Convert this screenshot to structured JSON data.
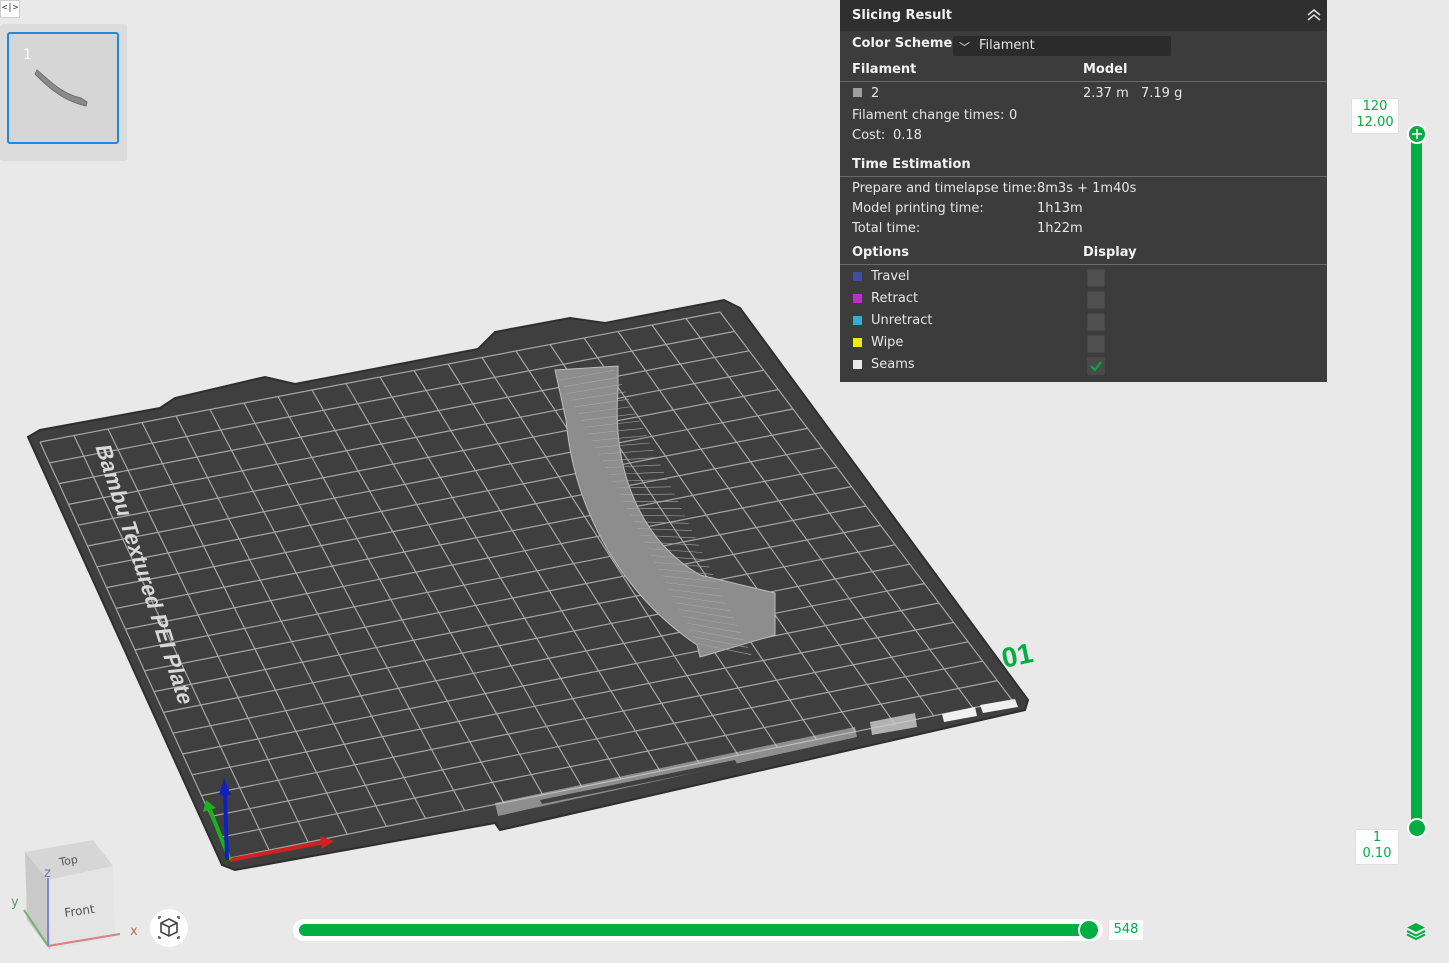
{
  "toolbar": {
    "collapse_icon": "code-bracket-icon",
    "collapse_label": "<|>"
  },
  "plates": [
    {
      "number": "1"
    }
  ],
  "plate": {
    "brand_text": "Bambu Textured PEI Plate",
    "plate_number": "01",
    "grid_color": "#a6a6a6",
    "plate_color": "#3f3f3f",
    "accent": "#00ae42"
  },
  "slicing_result": {
    "title": "Slicing Result",
    "color_scheme_label": "Color Scheme",
    "color_scheme_value": "Filament",
    "filament_header": "Filament",
    "model_header": "Model",
    "filament_rows": [
      {
        "id": "2",
        "length": "2.37 m",
        "weight": "7.19 g",
        "color": "#9e9e9e"
      }
    ],
    "filament_change_label": "Filament change times:",
    "filament_change_value": "0",
    "cost_label": "Cost:",
    "cost_value": "0.18",
    "time_header": "Time Estimation",
    "prepare_label": "Prepare and timelapse time:",
    "prepare_value": "8m3s + 1m40s",
    "model_time_label": "Model printing time:",
    "model_time_value": "1h13m",
    "total_label": "Total time:",
    "total_value": "1h22m",
    "options_header": "Options",
    "display_header": "Display",
    "options": [
      {
        "name": "Travel",
        "color": "#3f4ea0",
        "checked": false
      },
      {
        "name": "Retract",
        "color": "#c22ccf",
        "checked": false
      },
      {
        "name": "Unretract",
        "color": "#3aa8d8",
        "checked": false
      },
      {
        "name": "Wipe",
        "color": "#f2ea16",
        "checked": false
      },
      {
        "name": "Seams",
        "color": "#e8e8e8",
        "checked": true
      }
    ]
  },
  "layer_slider": {
    "top_layer": "120",
    "top_height": "12.00",
    "bottom_layer": "1",
    "bottom_height": "0.10"
  },
  "move_slider": {
    "value": "548",
    "fraction": 0.985
  },
  "view_cube": {
    "top": "Top",
    "front": "Front",
    "x": "x",
    "y": "y",
    "z": "z"
  }
}
